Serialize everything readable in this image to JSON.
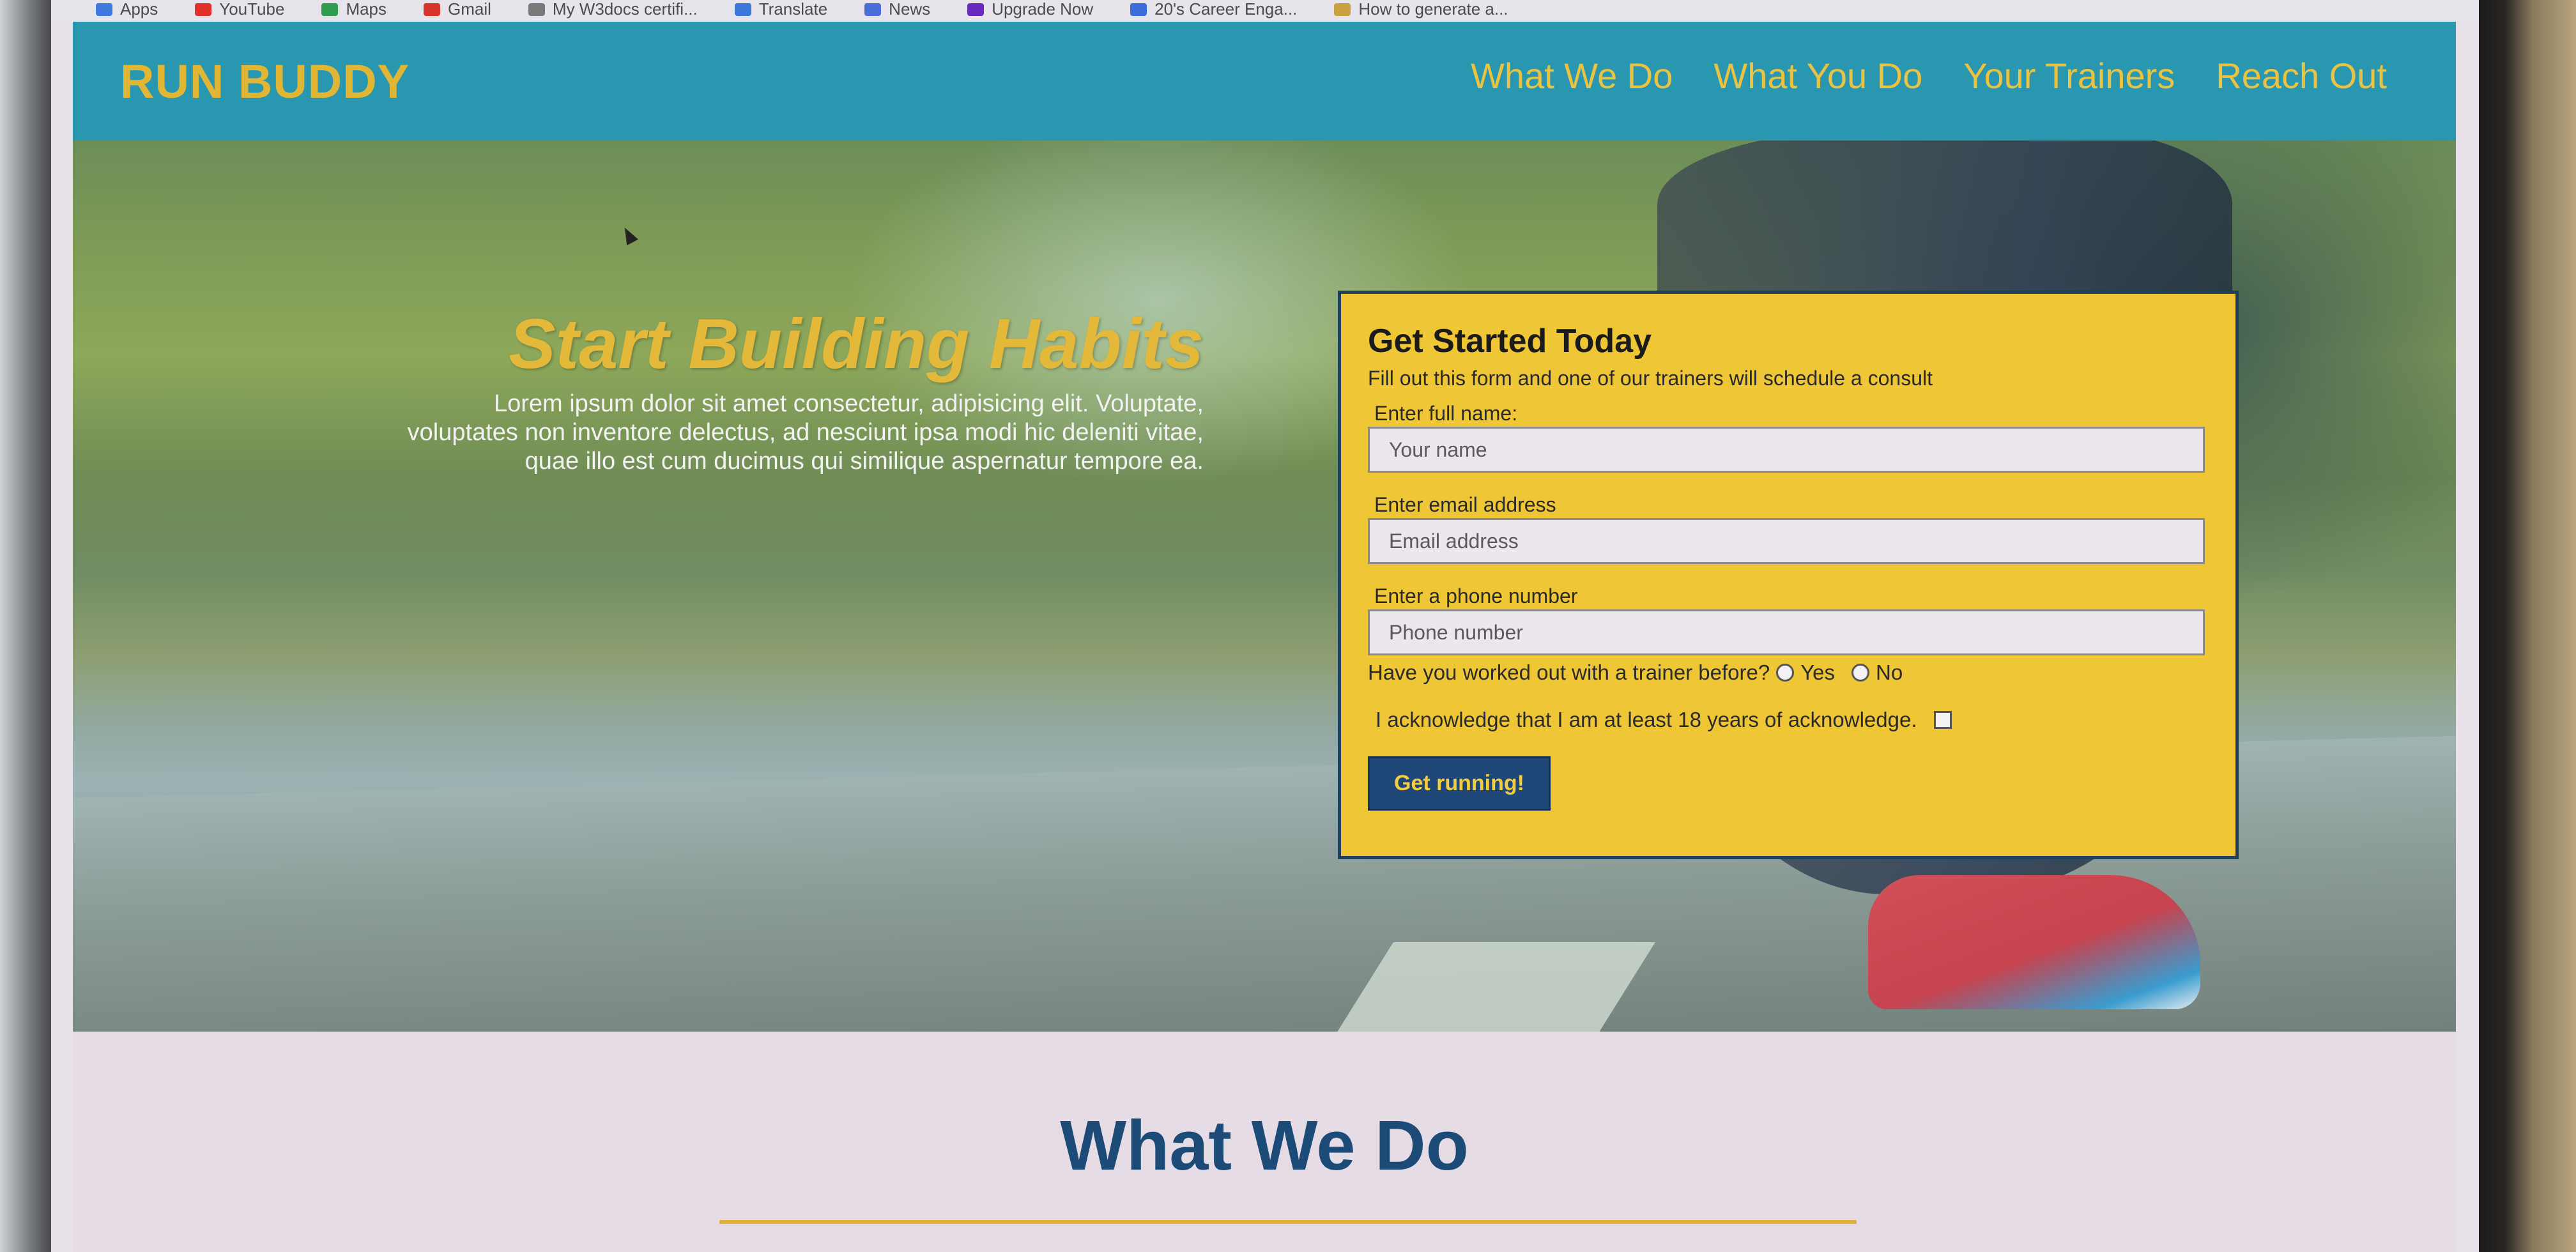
{
  "bookmarks": [
    {
      "label": "Apps",
      "color": "#3d7be0"
    },
    {
      "label": "YouTube",
      "color": "#e0302a"
    },
    {
      "label": "Maps",
      "color": "#2f9e4f"
    },
    {
      "label": "Gmail",
      "color": "#d9352b"
    },
    {
      "label": "My W3docs certifi...",
      "color": "#7a7a7a"
    },
    {
      "label": "Translate",
      "color": "#3b78d8"
    },
    {
      "label": "News",
      "color": "#4a6fd8"
    },
    {
      "label": "Upgrade Now",
      "color": "#6a2ac0"
    },
    {
      "label": "20's Career Enga...",
      "color": "#3b6ed8"
    },
    {
      "label": "How to generate a...",
      "color": "#c9a240"
    }
  ],
  "header": {
    "logo": "RUN BUDDY",
    "nav": [
      "What We Do",
      "What You Do",
      "Your Trainers",
      "Reach Out"
    ]
  },
  "hero": {
    "title": "Start Building Habits",
    "body": "Lorem ipsum dolor sit amet consectetur, adipisicing elit. Voluptate, voluptates non inventore delectus, ad nesciunt ipsa modi hic deleniti vitae, quae illo est cum ducimus qui similique aspernatur tempore ea."
  },
  "form": {
    "title": "Get Started Today",
    "subtitle": "Fill out this form and one of our trainers will schedule a consult",
    "name_label": "Enter full name:",
    "name_placeholder": "Your name",
    "email_label": "Enter email address",
    "email_placeholder": "Email address",
    "phone_label": "Enter a phone number",
    "phone_placeholder": "Phone number",
    "trainer_question": "Have you worked out with a trainer before?",
    "yes_label": "Yes",
    "no_label": "No",
    "acknowledge": "I acknowledge that I am at least 18 years of acknowledge.",
    "submit": "Get running!"
  },
  "section": {
    "title": "What We Do"
  },
  "colors": {
    "header_bg": "#2a97b0",
    "accent_yellow": "#e4b838",
    "form_bg": "#efc635",
    "button_bg": "#1f4778",
    "section_title": "#1d4b78"
  }
}
